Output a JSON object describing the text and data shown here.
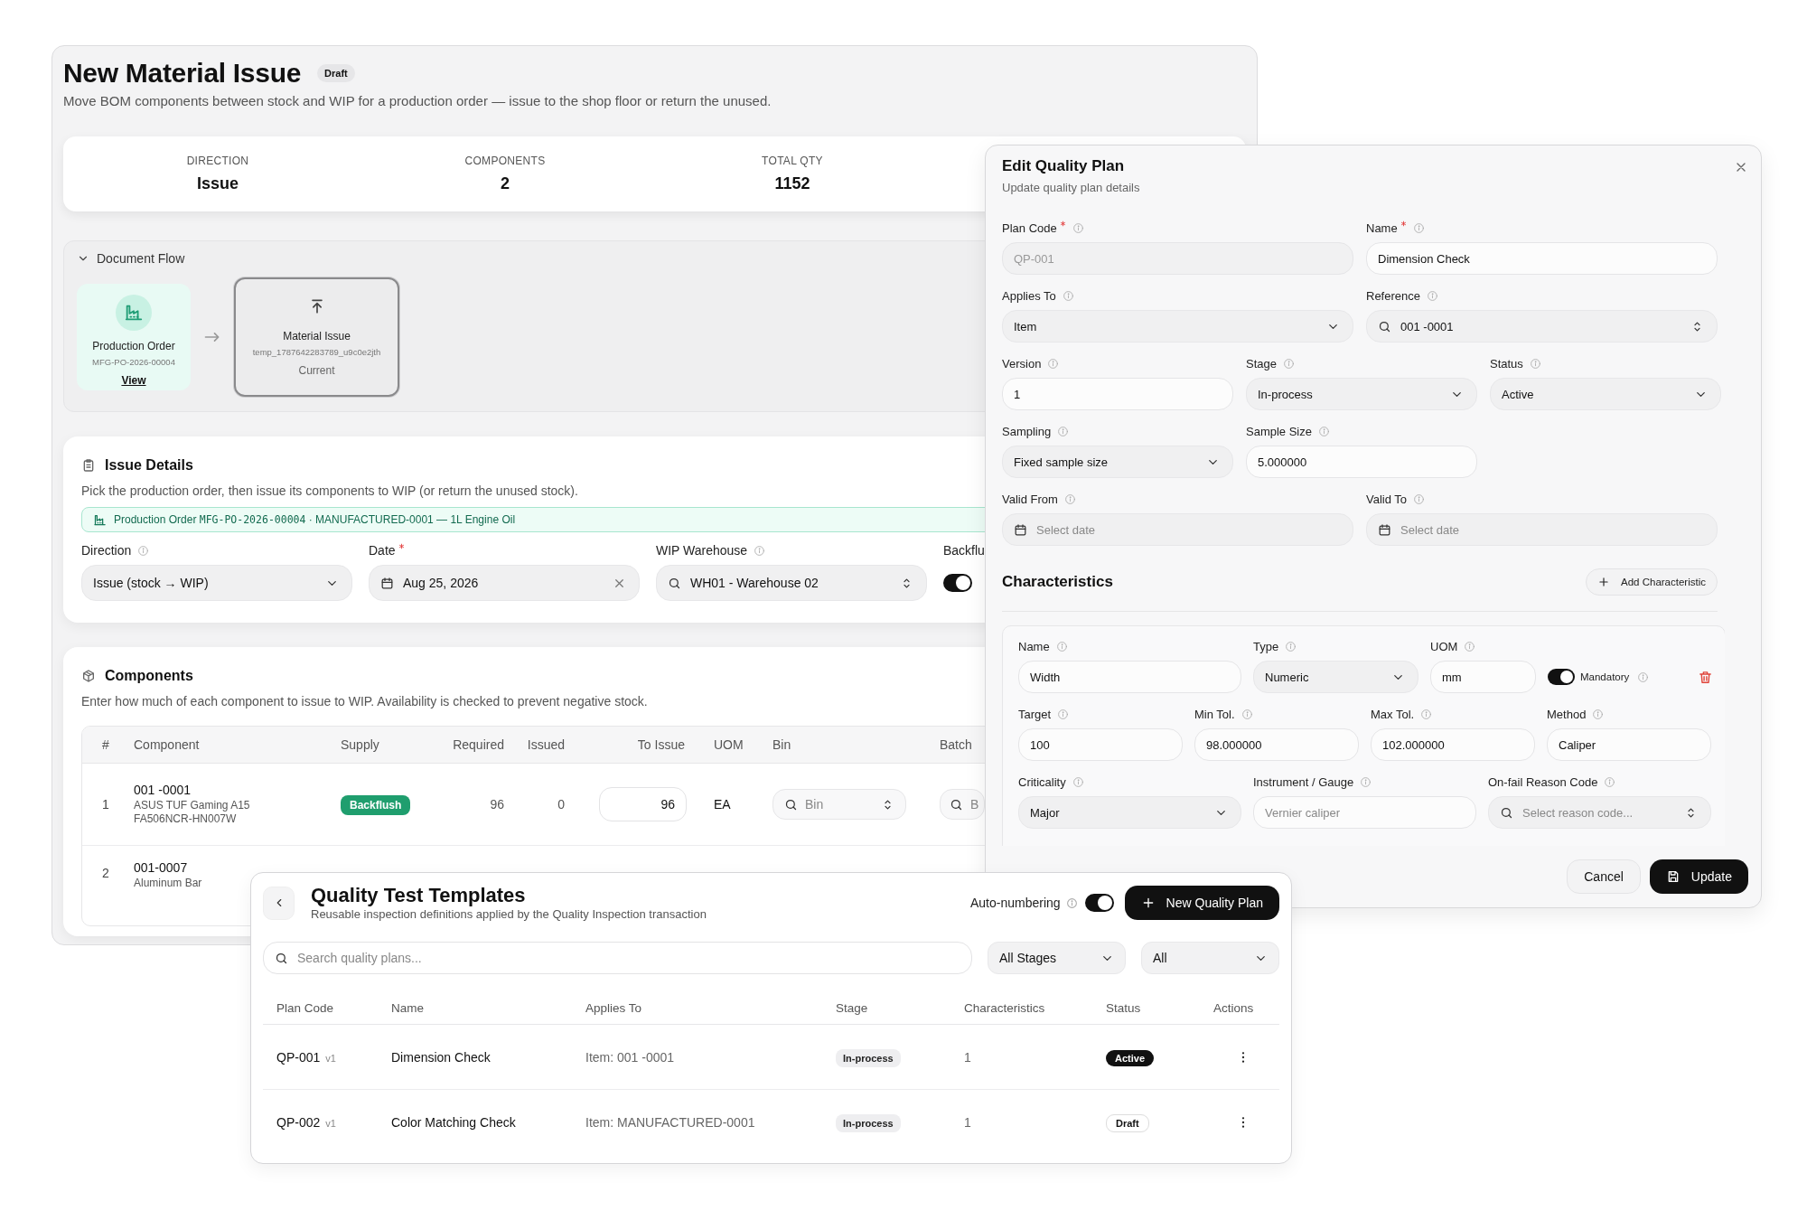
{
  "material_issue": {
    "title": "New Material Issue",
    "badge": "Draft",
    "subtitle": "Move BOM components between stock and WIP for a production order — issue to the shop floor or return the unused.",
    "stats": [
      {
        "label": "DIRECTION",
        "value": "Issue"
      },
      {
        "label": "COMPONENTS",
        "value": "2"
      },
      {
        "label": "TOTAL QTY",
        "value": "1152"
      }
    ],
    "document_flow": {
      "title": "Document Flow",
      "expanded": true,
      "nodes": [
        {
          "title": "Production Order",
          "code": "MFG-PO-2026-00004",
          "link": "View",
          "current": false
        },
        {
          "title": "Material Issue",
          "code": "temp_1787642283789_u9c0e2jth",
          "note": "Current",
          "current": true
        }
      ]
    },
    "issue_details": {
      "title": "Issue Details",
      "description": "Pick the production order, then issue its components to WIP (or return the unused stock).",
      "banner": {
        "label": "Production Order",
        "code": "MFG-PO-2026-00004",
        "detail": "· MANUFACTURED-0001 — 1L Engine Oil"
      },
      "fields": [
        {
          "kind": "select",
          "label": "Direction",
          "info": true,
          "required": false,
          "value": "Issue (stock → WIP)"
        },
        {
          "kind": "date",
          "label": "Date",
          "info": false,
          "required": true,
          "value": "Aug 25, 2026",
          "clearable": true
        },
        {
          "kind": "combobox",
          "label": "WIP Warehouse",
          "info": true,
          "required": false,
          "value": "WH01 - Warehouse 02"
        },
        {
          "kind": "toggle",
          "label": "Backflu",
          "on": true
        }
      ]
    },
    "components": {
      "title": "Components",
      "description": "Enter how much of each component to issue to WIP. Availability is checked to prevent negative stock.",
      "columns": [
        "#",
        "Component",
        "Supply",
        "Required",
        "Issued",
        "To Issue",
        "UOM",
        "Bin",
        "Batch"
      ],
      "rows": [
        {
          "index": "1",
          "code": "001 -0001",
          "description": "ASUS TUF Gaming A15 FA506NCR-HN007W",
          "supply": "Backflush",
          "required": "96",
          "issued": "0",
          "to_issue": "96",
          "uom": "EA",
          "bin_placeholder": "Bin",
          "batch_placeholder": "B"
        },
        {
          "index": "2",
          "code": "001-0007",
          "description": "Aluminum Bar"
        }
      ]
    }
  },
  "edit_quality_plan": {
    "title": "Edit Quality Plan",
    "subtitle": "Update quality plan details",
    "groups": [
      {
        "fields": [
          {
            "kind": "text",
            "label": "Plan Code",
            "required": true,
            "info": true,
            "value": "QP-001",
            "disabled": true
          },
          {
            "kind": "text",
            "label": "Name",
            "required": true,
            "info": true,
            "value": "Dimension Check",
            "disabled": false
          },
          {
            "kind": "select",
            "label": "Applies To",
            "required": false,
            "info": true,
            "value": "Item"
          },
          {
            "kind": "combobox",
            "label": "Reference",
            "required": false,
            "info": true,
            "value": "001 -0001"
          }
        ]
      },
      {
        "fields": [
          {
            "kind": "text",
            "label": "Version",
            "required": false,
            "info": true,
            "value": "1",
            "disabled": false
          },
          {
            "kind": "select",
            "label": "Stage",
            "required": false,
            "info": true,
            "value": "In-process"
          },
          {
            "kind": "select",
            "label": "Status",
            "required": false,
            "info": true,
            "value": "Active"
          },
          {
            "kind": "select",
            "label": "Sampling",
            "required": false,
            "info": true,
            "value": "Fixed sample size"
          },
          {
            "kind": "text",
            "label": "Sample Size",
            "required": false,
            "info": true,
            "value": "5.000000",
            "disabled": false
          }
        ]
      },
      {
        "fields": [
          {
            "kind": "date",
            "label": "Valid From",
            "required": false,
            "info": true,
            "placeholder": "Select date"
          },
          {
            "kind": "date",
            "label": "Valid To",
            "required": false,
            "info": true,
            "placeholder": "Select date"
          }
        ]
      }
    ],
    "characteristics": {
      "title": "Characteristics",
      "add_button": "Add Characteristic",
      "items": [
        {
          "fields": [
            {
              "kind": "text",
              "label": "Name",
              "info": true,
              "value": "Width"
            },
            {
              "kind": "select",
              "label": "Type",
              "info": true,
              "value": "Numeric"
            },
            {
              "kind": "text",
              "label": "UOM",
              "info": true,
              "value": "mm"
            },
            {
              "kind": "switch",
              "label": "Mandatory",
              "info": true,
              "on": true
            },
            {
              "kind": "text",
              "label": "Target",
              "info": true,
              "value": "100"
            },
            {
              "kind": "text",
              "label": "Min Tol.",
              "info": true,
              "value": "98.000000"
            },
            {
              "kind": "text",
              "label": "Max Tol.",
              "info": true,
              "value": "102.000000"
            },
            {
              "kind": "text",
              "label": "Method",
              "info": true,
              "value": "Caliper"
            },
            {
              "kind": "select",
              "label": "Criticality",
              "info": true,
              "value": "Major"
            },
            {
              "kind": "text",
              "label": "Instrument / Gauge",
              "info": true,
              "placeholder": "Vernier caliper"
            },
            {
              "kind": "combobox",
              "label": "On-fail Reason Code",
              "info": true,
              "placeholder": "Select reason code..."
            }
          ]
        }
      ]
    },
    "buttons": {
      "cancel": "Cancel",
      "update": "Update"
    }
  },
  "quality_test_templates": {
    "title": "Quality Test Templates",
    "subtitle": "Reusable inspection definitions applied by the Quality Inspection transaction",
    "auto_numbering": {
      "label": "Auto-numbering",
      "on": true
    },
    "new_button": "New Quality Plan",
    "search": {
      "placeholder": "Search quality plans..."
    },
    "filters": [
      "All Stages",
      "All"
    ],
    "columns": [
      "Plan Code",
      "Name",
      "Applies To",
      "Stage",
      "Characteristics",
      "Status",
      "Actions"
    ],
    "rows": [
      {
        "plan_code": "QP-001",
        "version": "v1",
        "name": "Dimension Check",
        "applies_to": "Item: 001 -0001",
        "stage": "In-process",
        "characteristics": "1",
        "status": {
          "label": "Active",
          "kind": "active"
        }
      },
      {
        "plan_code": "QP-002",
        "version": "v1",
        "name": "Color Matching Check",
        "applies_to": "Item: MANUFACTURED-0001",
        "stage": "In-process",
        "characteristics": "1",
        "status": {
          "label": "Draft",
          "kind": "draft"
        }
      }
    ]
  }
}
